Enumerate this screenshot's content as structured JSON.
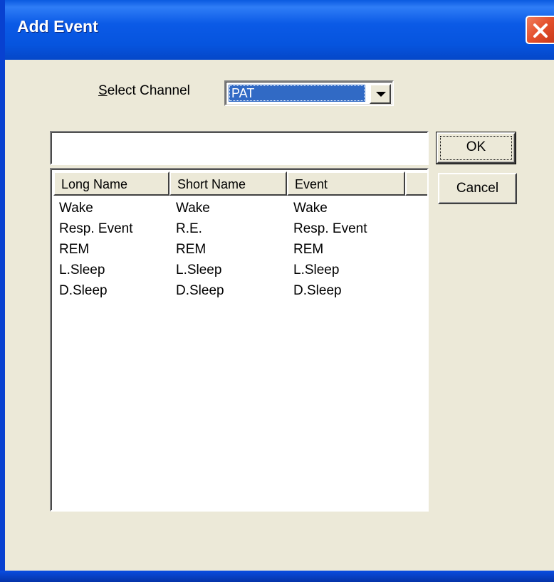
{
  "window": {
    "title": "Add Event",
    "close_icon": "close-x-icon"
  },
  "channel": {
    "label_prefix": "",
    "label_mnemonic": "S",
    "label_rest": "elect Channel",
    "selected": "PAT"
  },
  "name_input": {
    "value": ""
  },
  "buttons": {
    "ok": "OK",
    "cancel": "Cancel"
  },
  "table": {
    "columns": [
      "Long Name",
      "Short Name",
      "Event",
      ""
    ],
    "rows": [
      [
        "Wake",
        "Wake",
        "Wake"
      ],
      [
        "Resp. Event",
        "R.E.",
        "Resp. Event"
      ],
      [
        "REM",
        "REM",
        "REM"
      ],
      [
        "L.Sleep",
        "L.Sleep",
        "L.Sleep"
      ],
      [
        "D.Sleep",
        "D.Sleep",
        "D.Sleep"
      ]
    ]
  },
  "colors": {
    "titlebar": "#0a5ae0",
    "selection": "#316ac5",
    "face": "#ece9d8",
    "close": "#e4502c"
  }
}
